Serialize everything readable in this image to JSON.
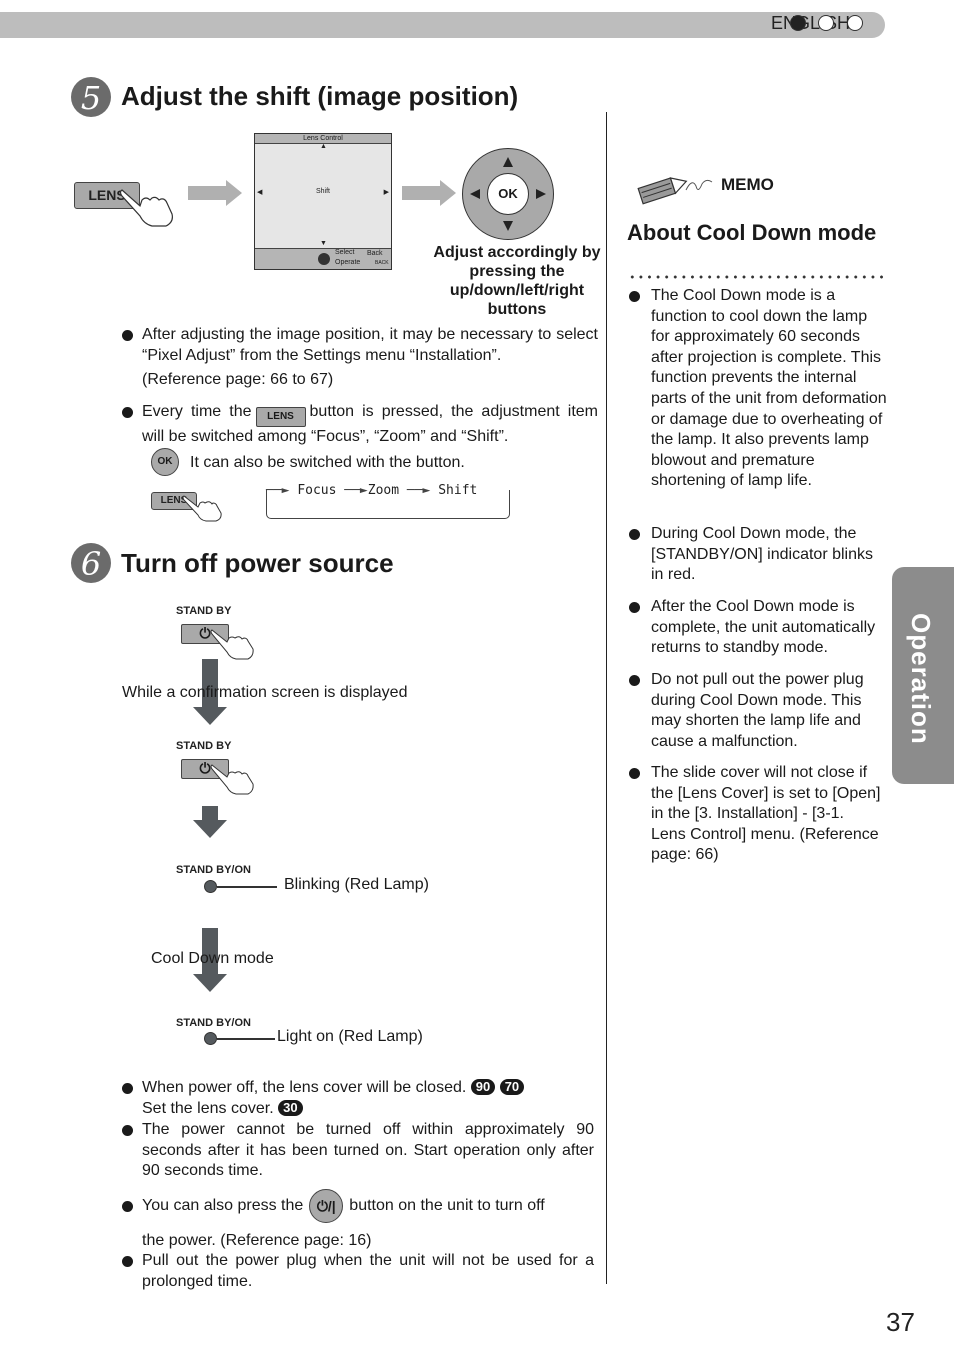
{
  "header": {
    "language": "ENGLISH",
    "language_dots": [
      "filled",
      "empty",
      "empty"
    ]
  },
  "step5": {
    "number": "5",
    "title": "Adjust the shift (image position)",
    "lens_button": "LENS",
    "screen": {
      "title": "Lens Control",
      "center": "Shift",
      "select": "Select",
      "operate": "Operate",
      "back": "Back",
      "back_key": "BACK"
    },
    "dpad_ok": "OK",
    "caption": "Adjust accordingly by pressing the up/down/left/right buttons",
    "bullets": [
      {
        "text": "After adjusting the image position, it may be necessary to select “Pixel Adjust” from the Settings menu “Installation”.",
        "reference": "(Reference page: 66 to 67)"
      },
      {
        "pre": "Every time the",
        "button": "LENS",
        "post": "button is pressed, the adjustment item will be switched among “Focus”, “Zoom” and “Shift”."
      }
    ],
    "ok_note": {
      "button": "OK",
      "text": "It can also be switched with the button."
    },
    "cycle": [
      "Focus",
      "Zoom",
      "Shift"
    ]
  },
  "step6": {
    "number": "6",
    "title": "Turn off power source",
    "flow": {
      "standby_label_1": "STAND BY",
      "confirmation_text": "While a confirmation screen is displayed",
      "standby_label_2": "STAND BY",
      "indicator_label_1": "STAND BY/ON",
      "indicator_state_1": "Blinking (Red Lamp)",
      "cooldown_text": "Cool Down mode",
      "indicator_label_2": "STAND BY/ON",
      "indicator_state_2": "Light on (Red Lamp)"
    },
    "bullets": [
      {
        "line1": "When power off, the lens cover will be closed.",
        "badges1": [
          "90",
          "70"
        ],
        "line2": "Set the lens cover.",
        "badges2": [
          "30"
        ]
      },
      {
        "text": "The power cannot be turned off within approximately 90 seconds after it has been turned on. Start operation only after 90 seconds time."
      },
      {
        "pre": "You can also press the",
        "button": "⏻/|",
        "post": "button on the unit to turn off",
        "line2": "the power. (Reference page: 16)"
      },
      {
        "text": "Pull out the power plug when the unit will not be used for a prolonged time."
      }
    ]
  },
  "memo": {
    "label": "MEMO",
    "title": "About Cool Down mode",
    "bullets": [
      "The Cool Down mode is a function to cool down the lamp for approximately 60 seconds after projection is complete. This function prevents the internal parts of the unit from deformation or damage due to overheating of the lamp. It also prevents lamp blowout and premature shortening of lamp life.",
      "During Cool Down mode, the [STANDBY/ON] indicator blinks in red.",
      "After the Cool Down mode is complete, the unit automatically returns to standby mode.",
      "Do not pull out the power plug during Cool Down mode. This may shorten the lamp life and cause a malfunction.",
      "The slide cover will not close if the [Lens Cover] is set to [Open] in the [3. Installation] - [3-1. Lens Control] menu. (Reference page: 66)"
    ]
  },
  "side_tab": "Operation",
  "page_number": "37"
}
